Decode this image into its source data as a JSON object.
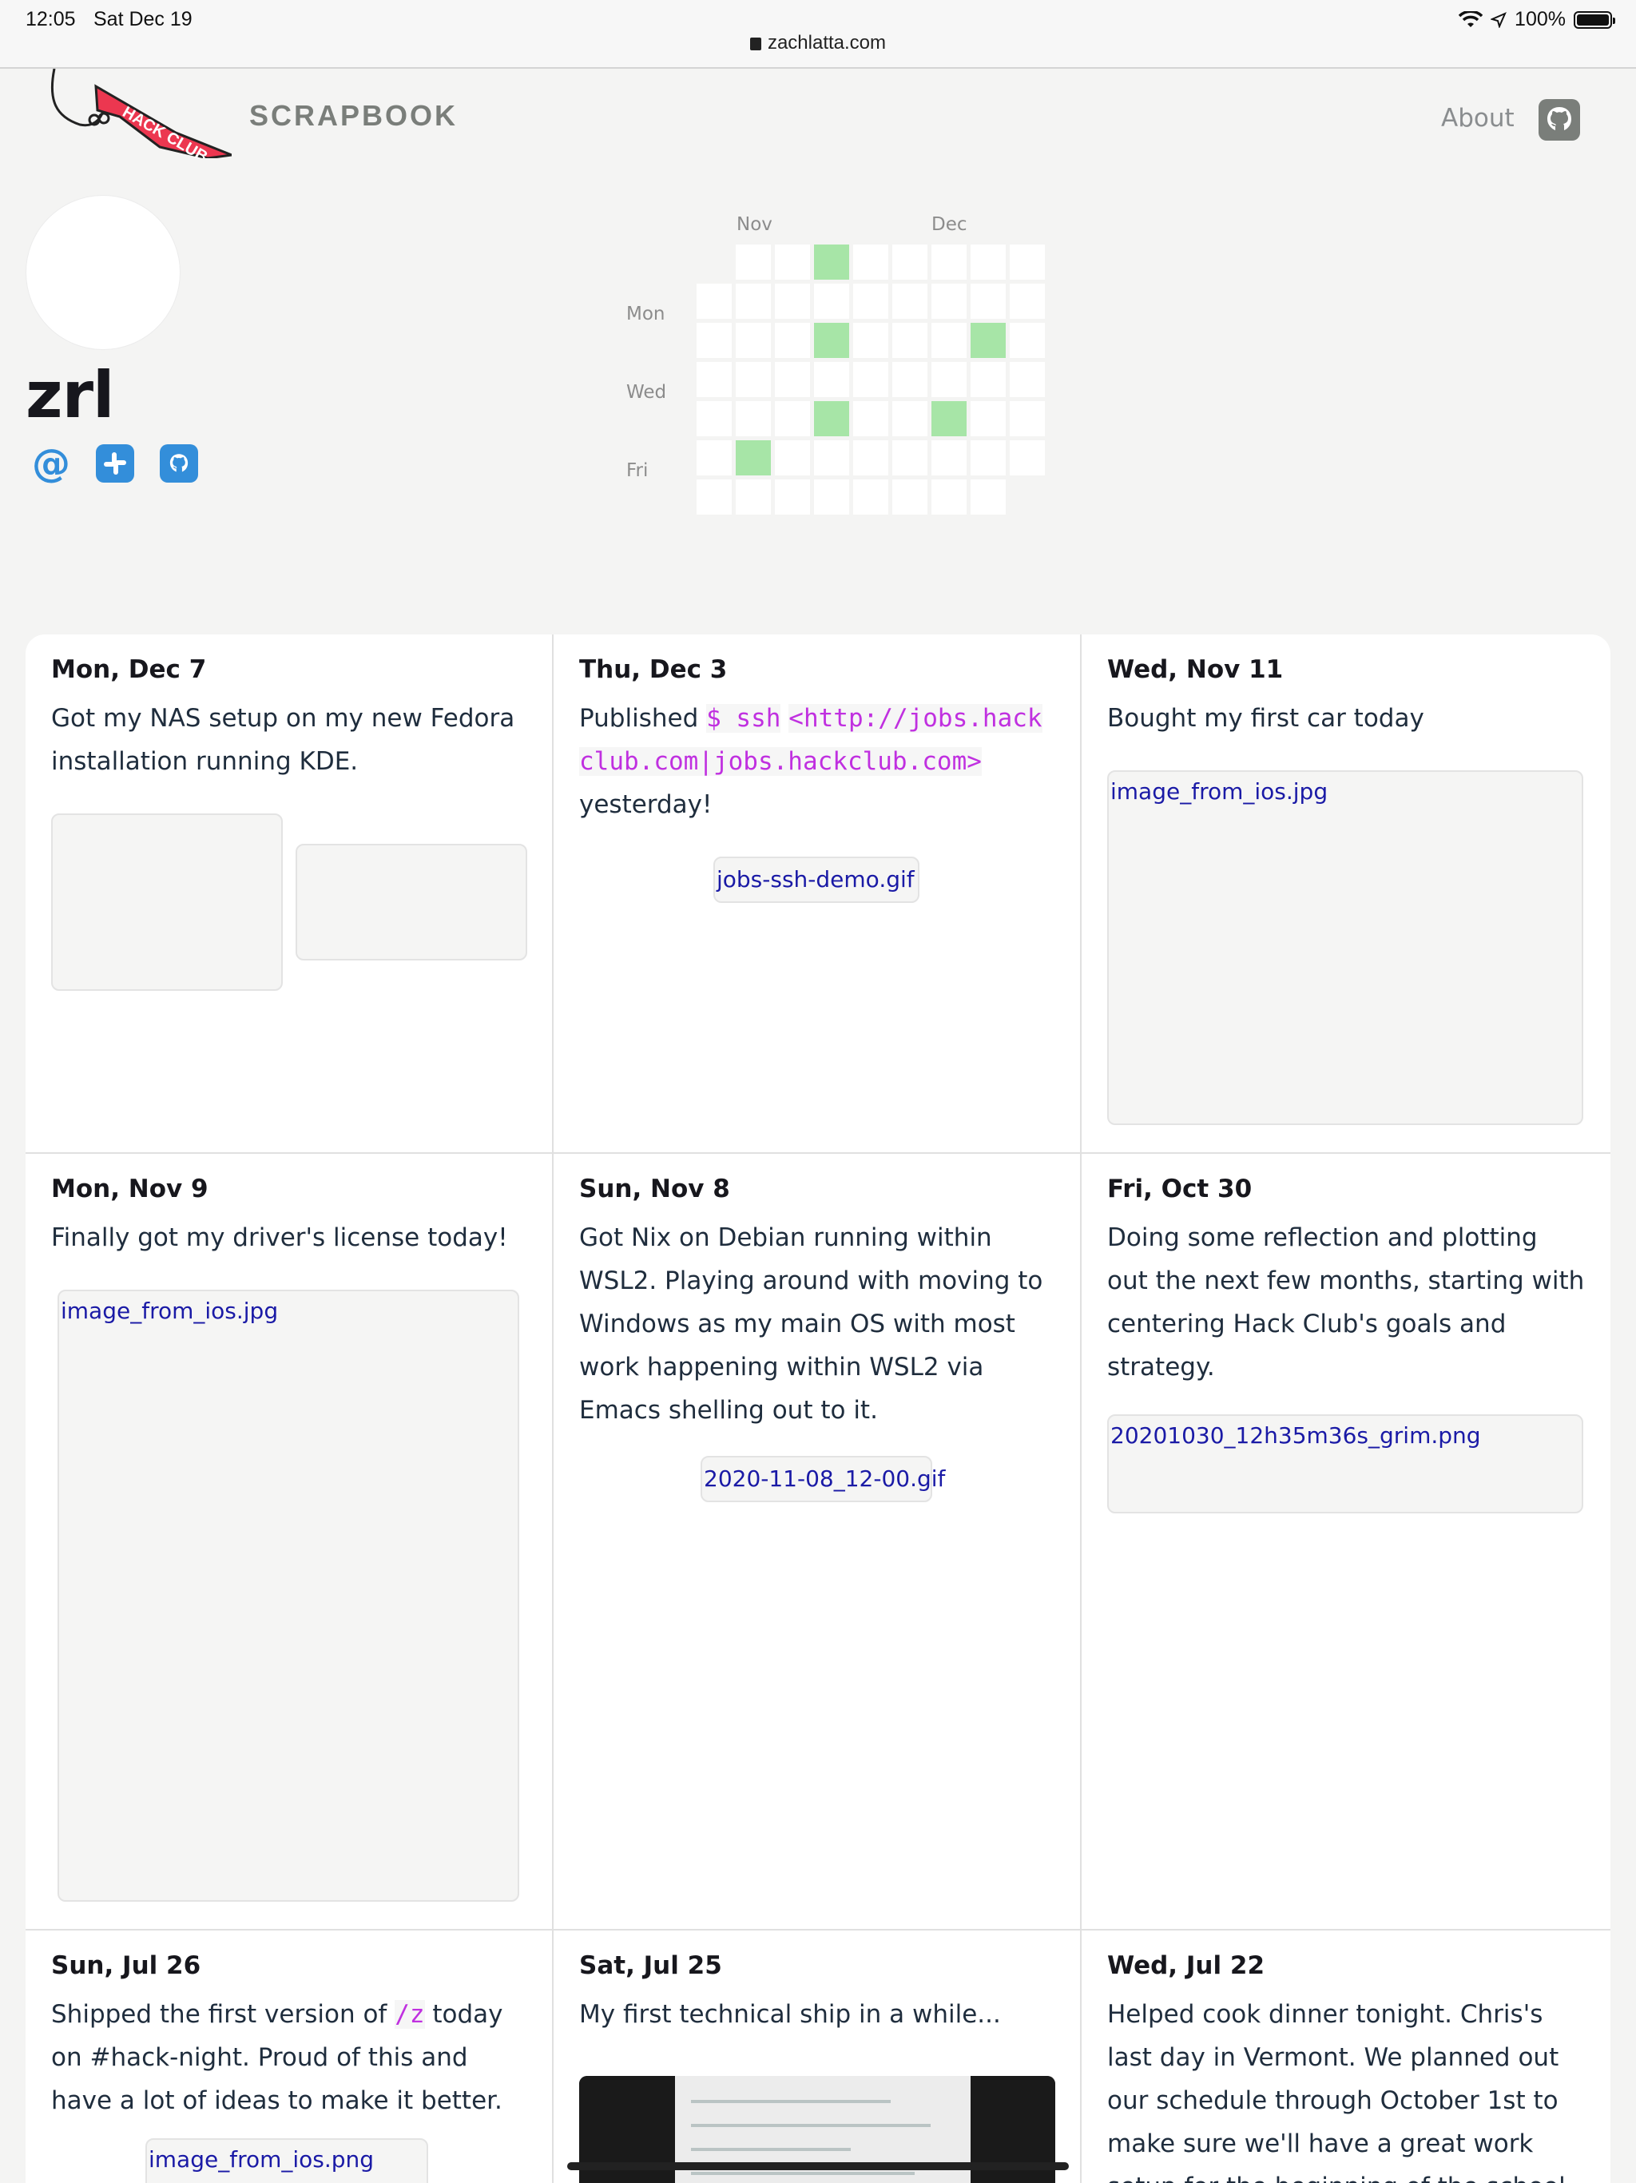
{
  "statusbar": {
    "time": "12:05",
    "date": "Sat Dec 19",
    "url": "zachlatta.com",
    "battery": "100%"
  },
  "header": {
    "brand": "SCRAPBOOK",
    "about": "About",
    "logo_text": "HACK CLUB"
  },
  "profile": {
    "username": "zrl",
    "social": [
      "at-icon",
      "slack-icon",
      "github-icon"
    ]
  },
  "heatmap": {
    "months": [
      "Nov",
      "Dec"
    ],
    "day_labels": [
      "Mon",
      "Wed",
      "Fri"
    ],
    "active_color": "#a7e5a7"
  },
  "posts": [
    {
      "date": "Mon, Dec 7",
      "text": "Got my NAS setup on my new Fedora installation running KDE."
    },
    {
      "date": "Thu, Dec 3",
      "text_before": "Published ",
      "code1": "$ ssh",
      "code2": "<http://jobs.hackclub.com|jobs.hackclub.com>",
      "text_after": " yesterday!",
      "attachment": "jobs-ssh-demo.gif"
    },
    {
      "date": "Wed, Nov 11",
      "text": "Bought my first car today",
      "attachment": "image_from_ios.jpg"
    },
    {
      "date": "Mon, Nov 9",
      "text": "Finally got my driver's license today!",
      "attachment": "image_from_ios.jpg"
    },
    {
      "date": "Sun, Nov 8",
      "text": "Got Nix on Debian running within WSL2. Playing around with moving to Windows as my main OS with most work happening within WSL2 via Emacs shelling out to it.",
      "attachment": "2020-11-08_12-00.gif"
    },
    {
      "date": "Fri, Oct 30",
      "text": "Doing some reflection and plotting out the next few months, starting with centering Hack Club's goals and strategy.",
      "attachment": "20201030_12h35m36s_grim.png"
    },
    {
      "date": "Sun, Jul 26",
      "text_before": "Shipped the first version of ",
      "code1": "/z",
      "text_after": " today on #hack-night. Proud of this and have a lot of ideas to make it better.",
      "attachment": "image_from_ios.png"
    },
    {
      "date": "Sat, Jul 25",
      "text": "My first technical ship in a while..."
    },
    {
      "date": "Wed, Jul 22",
      "text": "Helped cook dinner tonight. Chris's last day in Vermont. We planned out our schedule through October 1st to make sure we'll have a great work setup for the beginning of the school year."
    }
  ]
}
